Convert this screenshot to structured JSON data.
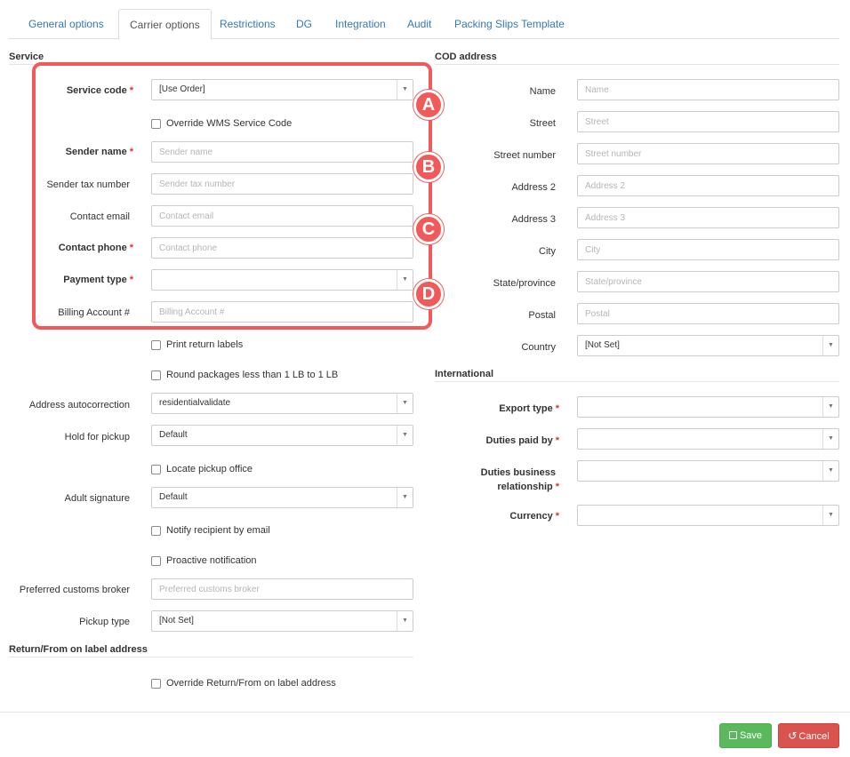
{
  "tabs": [
    "General options",
    "Carrier options",
    "Restrictions",
    "DG",
    "Integration",
    "Audit",
    "Packing Slips Template"
  ],
  "service": {
    "title": "Service",
    "service_code": {
      "label": "Service code",
      "value": "[Use Order]"
    },
    "override_wms": "Override WMS Service Code",
    "sender_name": {
      "label": "Sender name",
      "placeholder": "Sender name"
    },
    "sender_tax": {
      "label": "Sender tax number",
      "placeholder": "Sender tax number"
    },
    "contact_email": {
      "label": "Contact email",
      "placeholder": "Contact email"
    },
    "contact_phone": {
      "label": "Contact phone",
      "placeholder": "Contact phone"
    },
    "payment_type": {
      "label": "Payment type",
      "value": ""
    },
    "billing_account": {
      "label": "Billing Account #",
      "placeholder": "Billing Account #"
    },
    "print_return": "Print return labels",
    "round_packages": "Round packages less than 1 LB to 1 LB",
    "address_autocorrection": {
      "label": "Address autocorrection",
      "value": "residentialvalidate"
    },
    "hold_for_pickup": {
      "label": "Hold for pickup",
      "value": "Default"
    },
    "locate_pickup": "Locate pickup office",
    "adult_signature": {
      "label": "Adult signature",
      "value": "Default"
    },
    "notify_email": "Notify recipient by email",
    "proactive": "Proactive notification",
    "customs_broker": {
      "label": "Preferred customs broker",
      "placeholder": "Preferred customs broker"
    },
    "pickup_type": {
      "label": "Pickup type",
      "value": "[Not Set]"
    }
  },
  "return_from": {
    "title": "Return/From on label address",
    "override": "Override Return/From on label address"
  },
  "cod": {
    "title": "COD address",
    "name": {
      "label": "Name",
      "placeholder": "Name"
    },
    "street": {
      "label": "Street",
      "placeholder": "Street"
    },
    "street_number": {
      "label": "Street number",
      "placeholder": "Street number"
    },
    "address2": {
      "label": "Address 2",
      "placeholder": "Address 2"
    },
    "address3": {
      "label": "Address 3",
      "placeholder": "Address 3"
    },
    "city": {
      "label": "City",
      "placeholder": "City"
    },
    "state": {
      "label": "State/province",
      "placeholder": "State/province"
    },
    "postal": {
      "label": "Postal",
      "placeholder": "Postal"
    },
    "country": {
      "label": "Country",
      "value": "[Not Set]"
    }
  },
  "international": {
    "title": "International",
    "export_type": {
      "label": "Export type",
      "value": ""
    },
    "duties_paid_by": {
      "label": "Duties paid by",
      "value": ""
    },
    "duties_rel_line1": "Duties business",
    "duties_rel_line2": "relationship",
    "duties_rel_value": "",
    "currency": {
      "label": "Currency",
      "value": ""
    }
  },
  "annotations": {
    "a": "A",
    "b": "B",
    "c": "C",
    "d": "D"
  },
  "buttons": {
    "save": "Save",
    "cancel": "Cancel"
  },
  "colors": {
    "accent": "#337ab7",
    "highlight": "#f05a5a",
    "save": "#5cb85c",
    "cancel": "#d9534f"
  }
}
